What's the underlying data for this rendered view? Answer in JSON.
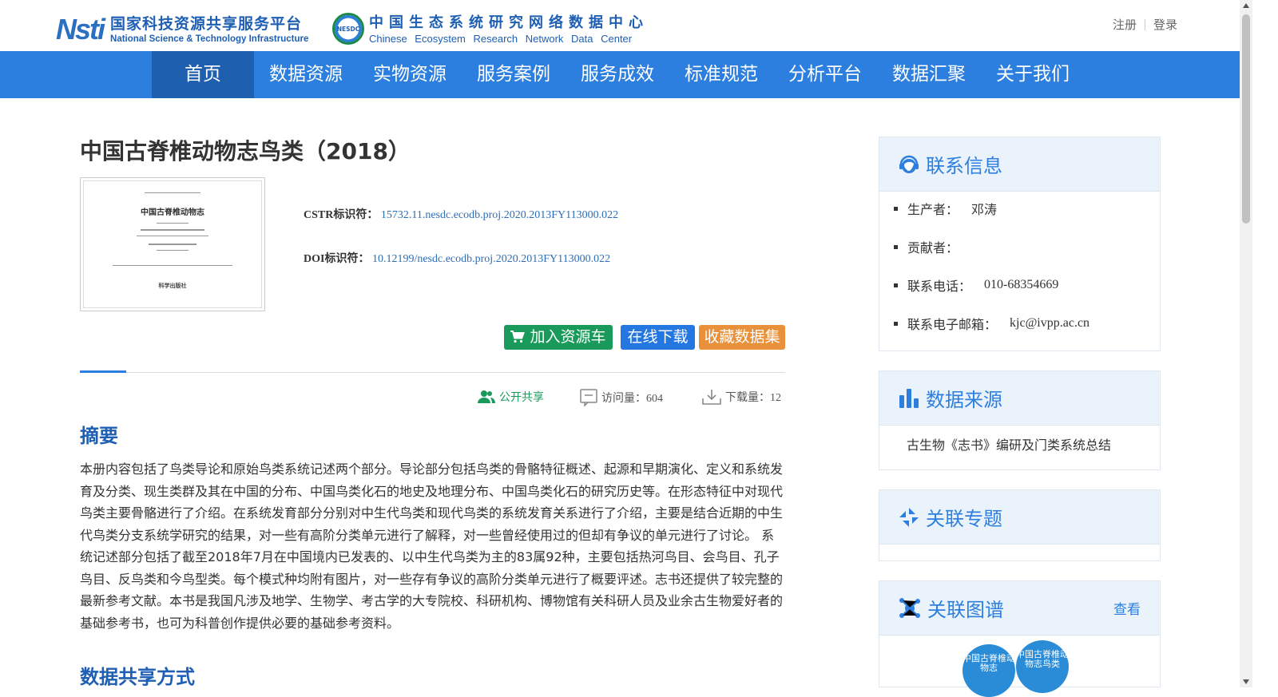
{
  "header": {
    "nstl_mark": "Nsti",
    "nstl_cn": "国家科技资源共享服务平台",
    "nstl_en": "National Science & Technology Infrastructure",
    "nesdc_badge": "NESDC",
    "nesdc_cn": "中国生态系统研究网络数据中心",
    "nesdc_en": "Chinese Ecosystem Research Network Data Center",
    "register": "注册",
    "login": "登录"
  },
  "nav": {
    "items": [
      "首页",
      "数据资源",
      "实物资源",
      "服务案例",
      "服务成效",
      "标准规范",
      "分析平台",
      "数据汇聚",
      "关于我们"
    ],
    "active_index": 0
  },
  "dataset": {
    "title": "中国古脊椎动物志鸟类（2018）",
    "cover": {
      "title": "中国古脊椎动物志",
      "publisher": "科学出版社"
    },
    "cstr_label": "CSTR标识符：",
    "cstr_value": "15732.11.nesdc.ecodb.proj.2020.2013FY113000.022",
    "doi_label": "DOI标识符：",
    "doi_value": "10.12199/nesdc.ecodb.proj.2020.2013FY113000.022"
  },
  "actions": {
    "cart": "加入资源车",
    "download": "在线下载",
    "favorite": "收藏数据集"
  },
  "stats": {
    "share": "公开共享",
    "visits": "访问量：604",
    "downloads": "下载量：12"
  },
  "abstract": {
    "heading": "摘要",
    "text": "本册内容包括了鸟类导论和原始鸟类系统记述两个部分。导论部分包括鸟类的骨骼特征概述、起源和早期演化、定义和系统发育及分类、现生类群及其在中国的分布、中国鸟类化石的地史及地理分布、中国鸟类化石的研究历史等。在形态特征中对现代鸟类主要骨骼进行了介绍。在系统发育部分分别对中生代鸟类和现代鸟类的系统发育关系进行了介绍，主要是结合近期的中生代鸟类分支系统学研究的结果，对一些有高阶分类单元进行了解释，对一些曾经使用过的但却有争议的单元进行了讨论。 系统记述部分包括了截至2018年7月在中国境内已发表的、以中生代鸟类为主的83属92种，主要包括热河鸟目、会鸟目、孔子鸟目、反鸟类和今鸟型类。每个模式种均附有图片，对一些存有争议的高阶分类单元进行了概要评述。志书还提供了较完整的最新参考文献。本书是我国凡涉及地学、生物学、考古学的大专院校、科研机构、博物馆有关科研人员及业余古生物爱好者的基础参考书，也可为科普创作提供必要的基础参考资料。"
  },
  "share_heading": "数据共享方式",
  "sidebar": {
    "contact": {
      "title": "联系信息",
      "items": [
        {
          "label": "生产者：",
          "value": "邓涛"
        },
        {
          "label": "贡献者：",
          "value": ""
        },
        {
          "label": "联系电话：",
          "value": "010-68354669"
        },
        {
          "label": "联系电子邮箱：",
          "value": "kjc@ivpp.ac.cn"
        }
      ]
    },
    "source": {
      "title": "数据来源",
      "value": "古生物《志书》编研及门类系统总结"
    },
    "topic": {
      "title": "关联专题"
    },
    "graph": {
      "title": "关联图谱",
      "more": "查看",
      "nodes": [
        "中国古脊椎动物志",
        "中国古脊椎动物志鸟类"
      ]
    }
  },
  "colors": {
    "nav": "#2d7fdf",
    "nav_active": "#1f5fb0",
    "cart": "#1a9a5a",
    "download": "#2477e0",
    "favorite": "#e8913a",
    "link": "#2d6db5"
  }
}
